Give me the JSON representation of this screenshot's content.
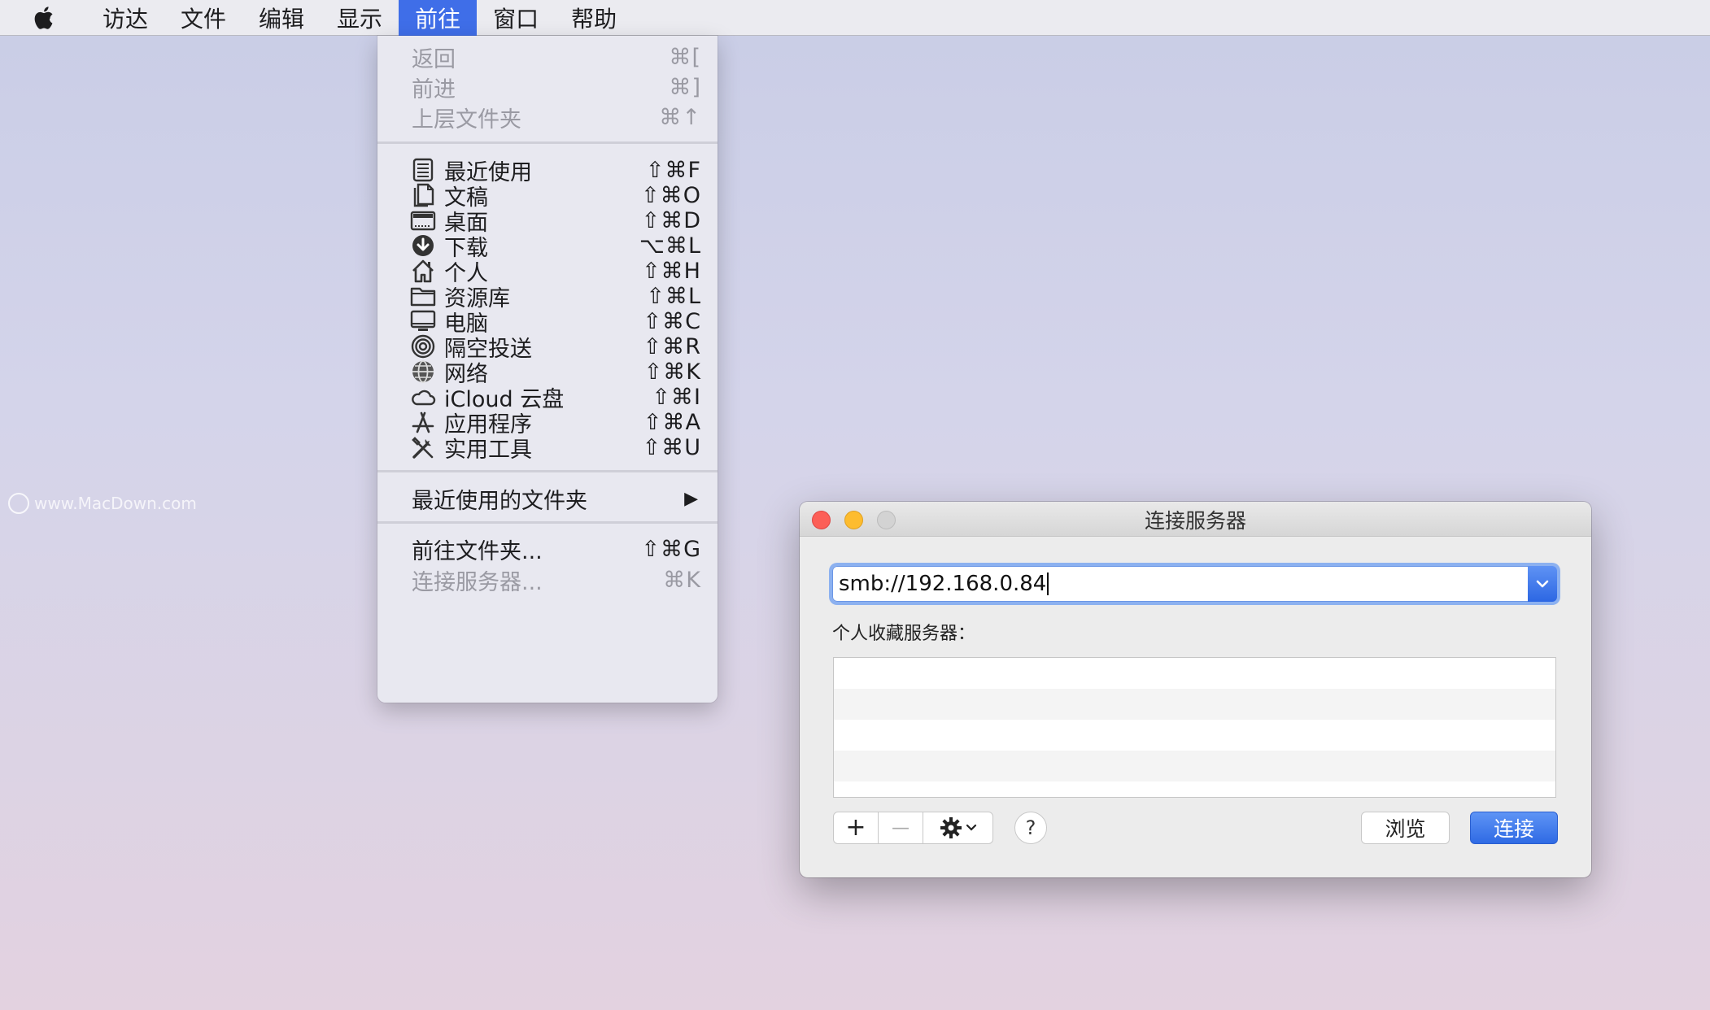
{
  "menubar": {
    "items": [
      "访达",
      "文件",
      "编辑",
      "显示",
      "前往",
      "窗口",
      "帮助"
    ],
    "active_index": 4
  },
  "go_menu": {
    "nav_items": [
      {
        "label": "返回",
        "shortcut": "⌘[",
        "enabled": false
      },
      {
        "label": "前进",
        "shortcut": "⌘]",
        "enabled": false
      },
      {
        "label": "上层文件夹",
        "shortcut": "⌘↑",
        "enabled": false
      }
    ],
    "place_items": [
      {
        "icon": "recents-icon",
        "label": "最近使用",
        "shortcut": "⇧⌘F"
      },
      {
        "icon": "documents-icon",
        "label": "文稿",
        "shortcut": "⇧⌘O"
      },
      {
        "icon": "desktop-icon",
        "label": "桌面",
        "shortcut": "⇧⌘D"
      },
      {
        "icon": "downloads-icon",
        "label": "下载",
        "shortcut": "⌥⌘L"
      },
      {
        "icon": "home-icon",
        "label": "个人",
        "shortcut": "⇧⌘H"
      },
      {
        "icon": "library-folder-icon",
        "label": "资源库",
        "shortcut": "⇧⌘L"
      },
      {
        "icon": "computer-icon",
        "label": "电脑",
        "shortcut": "⇧⌘C"
      },
      {
        "icon": "airdrop-icon",
        "label": "隔空投送",
        "shortcut": "⇧⌘R"
      },
      {
        "icon": "network-icon",
        "label": "网络",
        "shortcut": "⇧⌘K"
      },
      {
        "icon": "icloud-icon",
        "label": "iCloud 云盘",
        "shortcut": "⇧⌘I"
      },
      {
        "icon": "applications-icon",
        "label": "应用程序",
        "shortcut": "⇧⌘A"
      },
      {
        "icon": "utilities-icon",
        "label": "实用工具",
        "shortcut": "⇧⌘U"
      }
    ],
    "recent_folders": {
      "label": "最近使用的文件夹",
      "submenu_arrow": "▶"
    },
    "go_to_folder": {
      "label": "前往文件夹...",
      "shortcut": "⇧⌘G",
      "enabled": true
    },
    "connect_server": {
      "label": "连接服务器...",
      "shortcut": "⌘K",
      "enabled": false
    }
  },
  "watermark": {
    "text": "www.MacDown.com"
  },
  "dialog": {
    "title": "连接服务器",
    "address_value": "smb://192.168.0.84",
    "favorites_label": "个人收藏服务器：",
    "add_label": "+",
    "remove_label": "—",
    "help_label": "?",
    "browse_label": "浏览",
    "connect_label": "连接"
  },
  "colors": {
    "menu_highlight": "#3f6ee8",
    "primary_button": "#2f6ae4",
    "close": "#fc5f57",
    "minimize": "#fdbc2e"
  }
}
